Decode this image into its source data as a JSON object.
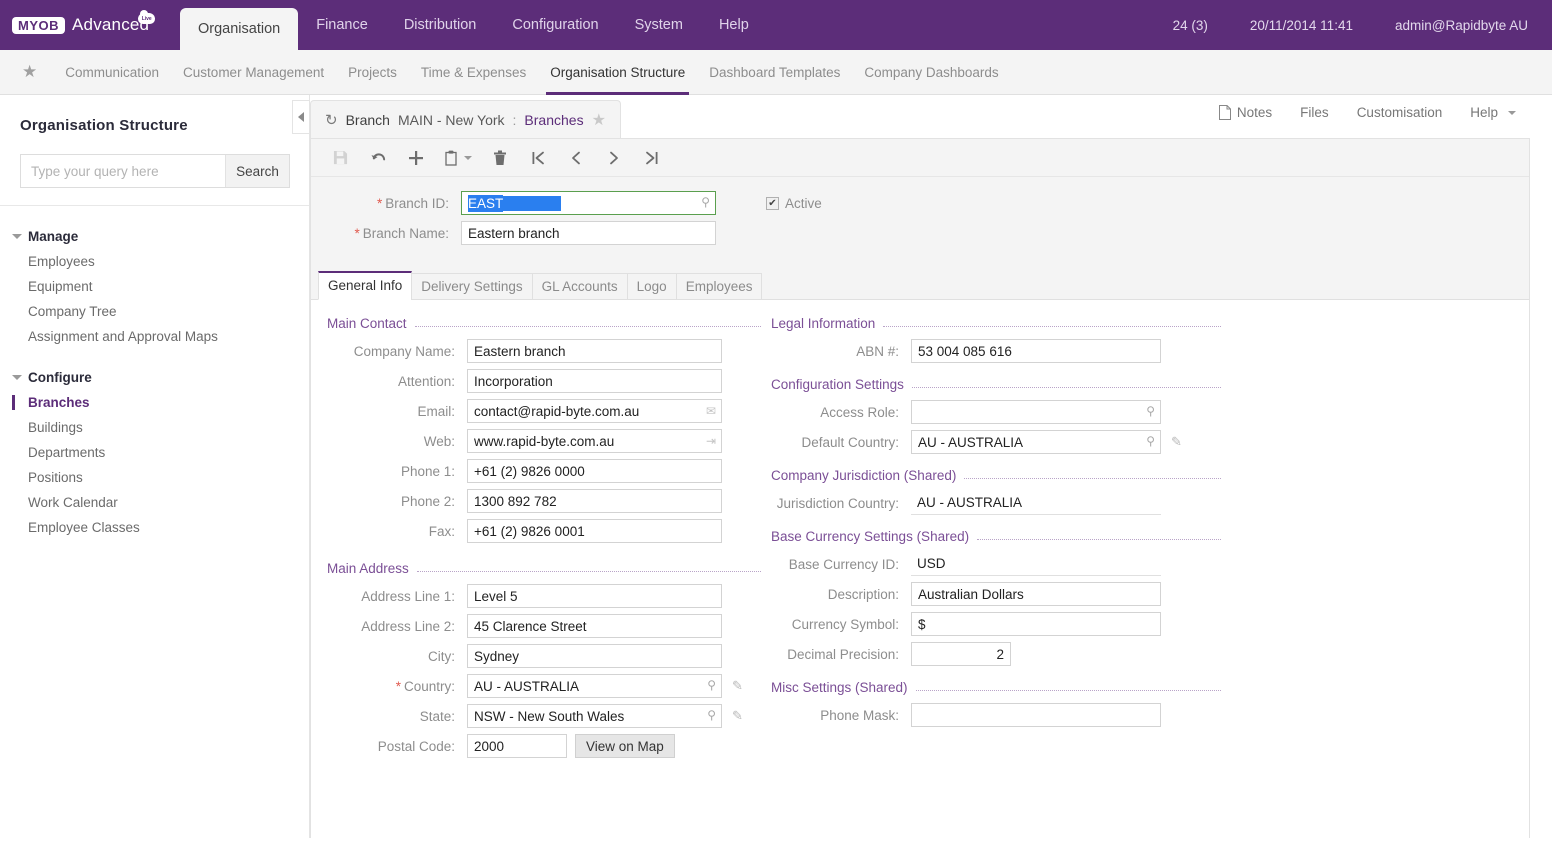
{
  "header": {
    "logo_myob": "MYOB",
    "logo_advanced": "Advanced",
    "logo_live": "Live",
    "tabs": [
      {
        "label": "Organisation",
        "active": true
      },
      {
        "label": "Finance",
        "active": false
      },
      {
        "label": "Distribution",
        "active": false
      },
      {
        "label": "Configuration",
        "active": false
      },
      {
        "label": "System",
        "active": false
      },
      {
        "label": "Help",
        "active": false
      }
    ],
    "notifications": "24 (3)",
    "datetime": "20/11/2014  11:41",
    "user": "admin@Rapidbyte AU"
  },
  "subnav": {
    "star_icon": "star-icon",
    "items": [
      {
        "label": "Communication",
        "active": false
      },
      {
        "label": "Customer Management",
        "active": false
      },
      {
        "label": "Projects",
        "active": false
      },
      {
        "label": "Time & Expenses",
        "active": false
      },
      {
        "label": "Organisation Structure",
        "active": true
      },
      {
        "label": "Dashboard Templates",
        "active": false
      },
      {
        "label": "Company Dashboards",
        "active": false
      }
    ]
  },
  "sidebar": {
    "title": "Organisation Structure",
    "search": {
      "placeholder": "Type your query here",
      "value": "",
      "button": "Search"
    },
    "groups": [
      {
        "label": "Manage",
        "items": [
          {
            "label": "Employees",
            "selected": false
          },
          {
            "label": "Equipment",
            "selected": false
          },
          {
            "label": "Company Tree",
            "selected": false
          },
          {
            "label": "Assignment and Approval Maps",
            "selected": false
          }
        ]
      },
      {
        "label": "Configure",
        "items": [
          {
            "label": "Branches",
            "selected": true
          },
          {
            "label": "Buildings",
            "selected": false
          },
          {
            "label": "Departments",
            "selected": false
          },
          {
            "label": "Positions",
            "selected": false
          },
          {
            "label": "Work Calendar",
            "selected": false
          },
          {
            "label": "Employee Classes",
            "selected": false
          }
        ]
      }
    ],
    "collapse_icon": "chevron-left-icon"
  },
  "document": {
    "refresh_icon": "refresh-icon",
    "breadcrumb_label": "Branch",
    "breadcrumb_value": "MAIN - New York",
    "breadcrumb_separator": ":",
    "breadcrumb_link": "Branches",
    "favourite_icon": "star-icon",
    "actions": [
      {
        "label": "Notes",
        "icon": "note-icon"
      },
      {
        "label": "Files",
        "icon": ""
      },
      {
        "label": "Customisation",
        "icon": ""
      },
      {
        "label": "Help",
        "icon": "chevron-down-icon"
      }
    ],
    "toolbar": [
      {
        "name": "save-button",
        "icon": "save-icon",
        "disabled": true
      },
      {
        "name": "undo-button",
        "icon": "undo-icon",
        "disabled": false
      },
      {
        "name": "add-button",
        "icon": "plus-icon",
        "disabled": false
      },
      {
        "name": "clipboard-button",
        "icon": "clipboard-icon",
        "disabled": false
      },
      {
        "name": "delete-button",
        "icon": "trash-icon",
        "disabled": false
      },
      {
        "name": "first-record-button",
        "icon": "first-icon",
        "disabled": false
      },
      {
        "name": "previous-record-button",
        "icon": "previous-icon",
        "disabled": false
      },
      {
        "name": "next-record-button",
        "icon": "next-icon",
        "disabled": false
      },
      {
        "name": "last-record-button",
        "icon": "last-icon",
        "disabled": false
      }
    ]
  },
  "form": {
    "branch_id": {
      "label": "Branch ID:",
      "value": "EAST",
      "required": true,
      "focused": true,
      "selected": true
    },
    "branch_name": {
      "label": "Branch Name:",
      "value": "Eastern branch",
      "required": true
    },
    "active": {
      "label": "Active",
      "checked": true
    },
    "tabs": [
      {
        "label": "General Info",
        "active": true
      },
      {
        "label": "Delivery Settings",
        "active": false
      },
      {
        "label": "GL Accounts",
        "active": false
      },
      {
        "label": "Logo",
        "active": false
      },
      {
        "label": "Employees",
        "active": false
      }
    ],
    "main_contact": {
      "title": "Main Contact",
      "fields": [
        {
          "label": "Company Name:",
          "value": "Eastern branch",
          "icon": ""
        },
        {
          "label": "Attention:",
          "value": "Incorporation",
          "icon": ""
        },
        {
          "label": "Email:",
          "value": "contact@rapid-byte.com.au",
          "icon": "envelope-icon"
        },
        {
          "label": "Web:",
          "value": "www.rapid-byte.com.au",
          "icon": "external-link-icon"
        },
        {
          "label": "Phone 1:",
          "value": "+61 (2) 9826 0000",
          "icon": ""
        },
        {
          "label": "Phone 2:",
          "value": "1300 892 782",
          "icon": ""
        },
        {
          "label": "Fax:",
          "value": "+61 (2) 9826 0001",
          "icon": ""
        }
      ]
    },
    "main_address": {
      "title": "Main Address",
      "fields": [
        {
          "label": "Address Line 1:",
          "value": "Level 5"
        },
        {
          "label": "Address Line 2:",
          "value": "45 Clarence Street"
        },
        {
          "label": "City:",
          "value": "Sydney"
        },
        {
          "label": "Country:",
          "value": "AU - AUSTRALIA",
          "required": true,
          "lookup": true,
          "pencil": true
        },
        {
          "label": "State:",
          "value": "NSW - New South Wales",
          "lookup": true,
          "pencil": true
        },
        {
          "label": "Postal Code:",
          "value": "2000"
        }
      ],
      "view_on_map": "View on Map"
    },
    "legal_information": {
      "title": "Legal Information",
      "fields": [
        {
          "label": "ABN #:",
          "value": "53 004 085 616"
        }
      ]
    },
    "configuration_settings": {
      "title": "Configuration Settings",
      "fields": [
        {
          "label": "Access Role:",
          "value": "",
          "lookup": true
        },
        {
          "label": "Default Country:",
          "value": "AU - AUSTRALIA",
          "lookup": true,
          "pencil": true
        }
      ]
    },
    "company_jurisdiction": {
      "title": "Company Jurisdiction (Shared)",
      "fields": [
        {
          "label": "Jurisdiction Country:",
          "value": "AU - AUSTRALIA",
          "readonly": true
        }
      ]
    },
    "base_currency_settings": {
      "title": "Base Currency Settings (Shared)",
      "fields": [
        {
          "label": "Base Currency ID:",
          "value": "USD",
          "readonly": true
        },
        {
          "label": "Description:",
          "value": "Australian Dollars"
        },
        {
          "label": "Currency Symbol:",
          "value": "$"
        },
        {
          "label": "Decimal Precision:",
          "value": "2",
          "numeric": true
        }
      ]
    },
    "misc_settings": {
      "title": "Misc Settings (Shared)",
      "fields": [
        {
          "label": "Phone Mask:",
          "value": ""
        }
      ]
    }
  },
  "colors": {
    "brand_purple": "#5c2d79",
    "selection_blue": "#2a7fef",
    "focus_green": "#5a9f4e",
    "required_red": "#e05a4f"
  }
}
